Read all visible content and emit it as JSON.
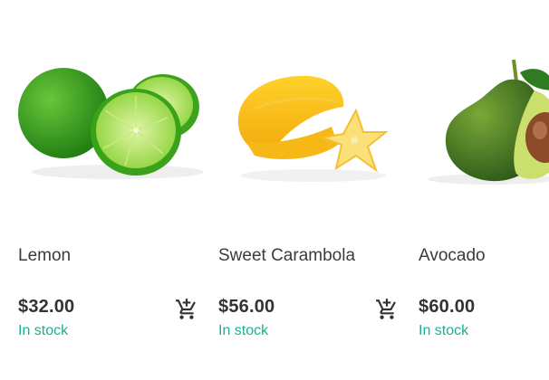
{
  "products": [
    {
      "name": "Lemon",
      "price": "$32.00",
      "stock": "In stock",
      "image": "lime-photo",
      "cart_icon": "add-to-cart-icon"
    },
    {
      "name": "Sweet Carambola",
      "price": "$56.00",
      "stock": "In stock",
      "image": "carambola-photo",
      "cart_icon": "add-to-cart-icon"
    },
    {
      "name": "Avocado",
      "price": "$60.00",
      "stock": "In stock",
      "image": "avocado-photo",
      "cart_icon": "add-to-cart-icon"
    }
  ],
  "colors": {
    "stock": "#18b191",
    "price": "#333333",
    "name": "#3b3b3b",
    "icon": "#333333"
  }
}
